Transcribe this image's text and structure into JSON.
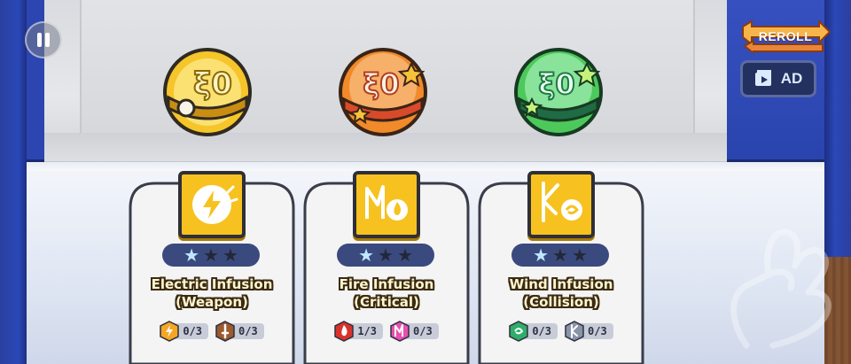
{
  "hud": {
    "pause_icon": "pause-icon",
    "reroll_label": "REROLL",
    "ad_label": "AD",
    "ad_icon": "video-icon"
  },
  "orbs": [
    {
      "name": "electric-orb",
      "color": "#f5c52a"
    },
    {
      "name": "fire-orb",
      "color": "#f08a2a"
    },
    {
      "name": "wind-orb",
      "color": "#4cc95a"
    }
  ],
  "cards": [
    {
      "icon": "lightning-icon",
      "stars_filled": 1,
      "stars_total": 3,
      "title_line1": "Electric Infusion",
      "title_line2": "(Weapon)",
      "reqs": [
        {
          "icon": "electric-element-icon",
          "color": "#f5a623",
          "count": "0/3"
        },
        {
          "icon": "weapon-trait-icon",
          "color": "#9c5a2e",
          "count": "0/3"
        }
      ]
    },
    {
      "icon": "fire-critical-icon",
      "stars_filled": 1,
      "stars_total": 3,
      "title_line1": "Fire Infusion",
      "title_line2": "(Critical)",
      "reqs": [
        {
          "icon": "fire-element-icon",
          "color": "#d9322c",
          "count": "1/3"
        },
        {
          "icon": "critical-trait-icon",
          "color": "#e84fb0",
          "count": "0/3"
        }
      ]
    },
    {
      "icon": "wind-collision-icon",
      "stars_filled": 1,
      "stars_total": 3,
      "title_line1": "Wind Infusion",
      "title_line2": "(Collision)",
      "reqs": [
        {
          "icon": "wind-element-icon",
          "color": "#2fae6a",
          "count": "0/3"
        },
        {
          "icon": "collision-trait-icon",
          "color": "#8a94a8",
          "count": "0/3"
        }
      ]
    }
  ]
}
